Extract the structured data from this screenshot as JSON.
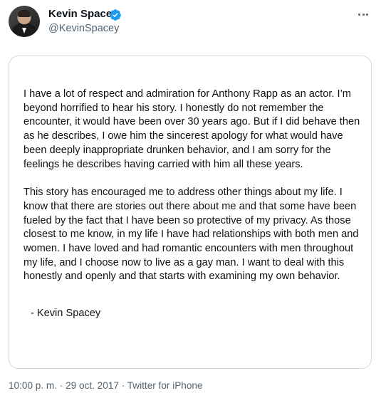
{
  "author": {
    "name": "Kevin Spacey",
    "handle": "@KevinSpacey",
    "verified": true,
    "avatar_icon": "profile-avatar"
  },
  "more_icon": "ellipsis-icon",
  "statement": {
    "paragraph_1": "I have a lot of respect and admiration for Anthony Rapp as an actor. I’m beyond horrified to hear his story. I honestly do not remember the encounter, it would have been over 30 years ago. But if I did behave then as he describes, I owe him the sincerest apology for what would have been deeply inappropriate drunken behavior, and I am sorry for the feelings he describes having carried with him all these years.",
    "paragraph_2": "This story has encouraged me to address other things about my life. I know that there are stories out there about me and that some have been fueled by the fact that I have been so protective of my privacy. As those closest to me know, in my life I have had relationships with both men and women. I have loved and had romantic encounters with men throughout my life, and I choose now to live as a gay man.  I want to deal with this honestly and openly and that starts with examining my own behavior.",
    "signature": "- Kevin Spacey"
  },
  "meta": "10:00 p. m. · 29 oct. 2017 · Twitter for iPhone",
  "colors": {
    "verified_badge": "#1d9bf0",
    "secondary_text": "#536471",
    "border": "#cfd9de"
  }
}
